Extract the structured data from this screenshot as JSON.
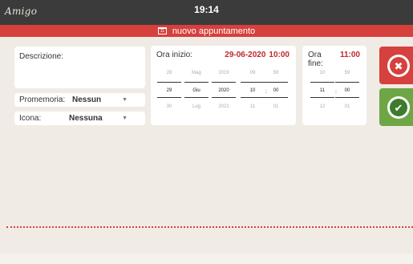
{
  "status": {
    "brand": "Amigo",
    "time": "19:14"
  },
  "title": {
    "icon": "calendar-icon",
    "icon_num": "11",
    "text": "nuovo appuntamento"
  },
  "description": {
    "label": "Descrizione:"
  },
  "reminder": {
    "label": "Promemoria:",
    "value": "Nessun",
    "caret": "▼"
  },
  "icon_select": {
    "label": "Icona:",
    "value": "Nessuna",
    "caret": "▼"
  },
  "start": {
    "label": "Ora inizio:",
    "date": "29-06-2020",
    "time": "10:00",
    "day": {
      "prev": "28",
      "sel": "29",
      "next": "30"
    },
    "month": {
      "prev": "Mag",
      "sel": "Giu",
      "next": "Lug"
    },
    "year": {
      "prev": "2019",
      "sel": "2020",
      "next": "2021"
    },
    "hour": {
      "prev": "09",
      "sel": "10",
      "next": "11"
    },
    "minute": {
      "prev": "59",
      "sel": "00",
      "next": "01"
    }
  },
  "end": {
    "label": "Ora fine:",
    "time": "11:00",
    "hour": {
      "prev": "10",
      "sel": "11",
      "next": "12"
    },
    "minute": {
      "prev": "59",
      "sel": "00",
      "next": "01"
    }
  },
  "buttons": {
    "cancel_icon": "close-icon",
    "confirm_icon": "check-icon",
    "cancel_glyph": "✖",
    "confirm_glyph": "✔"
  },
  "colors": {
    "accent": "#d6403d",
    "confirm": "#6fa645",
    "background": "#f1ebe5"
  }
}
